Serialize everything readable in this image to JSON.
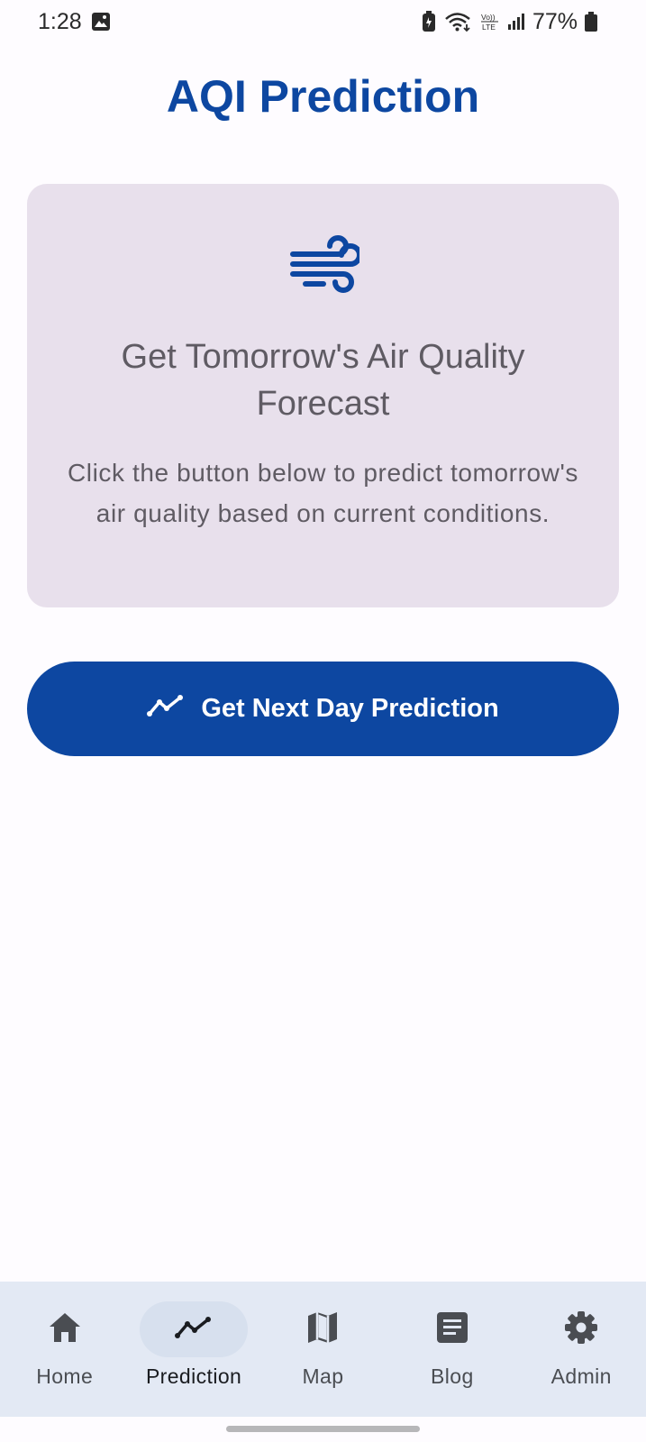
{
  "status_bar": {
    "time": "1:28",
    "battery": "77%",
    "icons": [
      "gallery-icon",
      "battery-saver-icon",
      "wifi-icon",
      "volte-icon",
      "signal-icon",
      "battery-icon"
    ]
  },
  "title": "AQI Prediction",
  "card": {
    "icon": "wind-icon",
    "heading": "Get Tomorrow's Air Quality Forecast",
    "text": "Click the button below to predict tomorrow's air quality based on current conditions."
  },
  "predict_button": {
    "label": "Get Next Day Prediction",
    "icon": "trending-icon"
  },
  "nav": {
    "items": [
      {
        "label": "Home",
        "icon": "home-icon",
        "active": false
      },
      {
        "label": "Prediction",
        "icon": "trending-icon",
        "active": true
      },
      {
        "label": "Map",
        "icon": "map-icon",
        "active": false
      },
      {
        "label": "Blog",
        "icon": "article-icon",
        "active": false
      },
      {
        "label": "Admin",
        "icon": "gear-icon",
        "active": false
      }
    ]
  },
  "colors": {
    "primary": "#0d47a1",
    "card_background": "#e8e0ec",
    "nav_background": "#e3e9f4",
    "nav_active_pill": "#d7e0ee"
  }
}
